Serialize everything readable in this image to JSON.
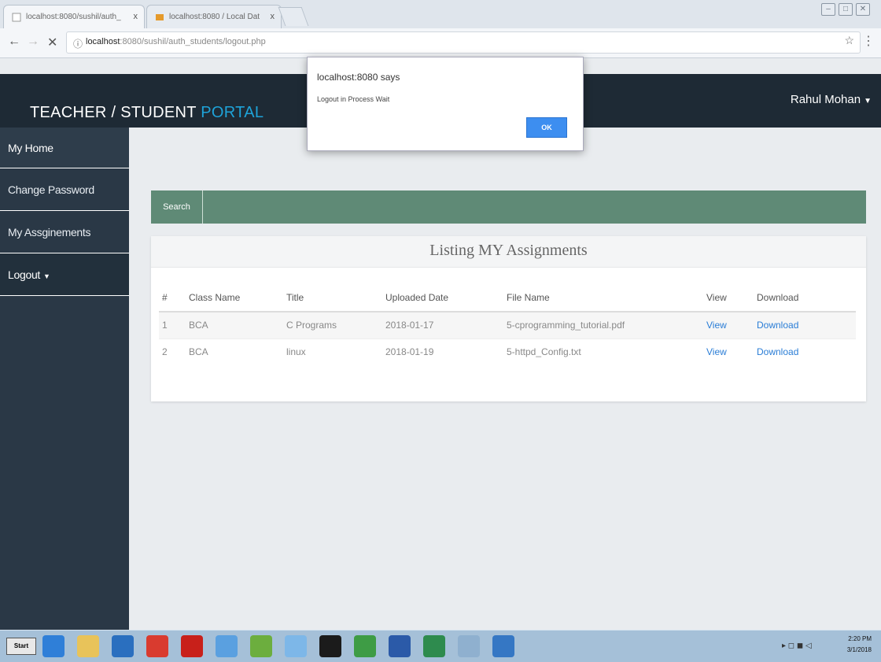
{
  "browser": {
    "tabs": [
      {
        "label": "localhost:8080/sushil/auth_",
        "close": "x"
      },
      {
        "label": "localhost:8080 / Local Dat",
        "close": "x"
      }
    ],
    "url_host": "localhost",
    "url_path": ":8080/sushil/auth_students/logout.php",
    "back_glyph": "←",
    "forward_glyph": "→",
    "stop_glyph": "✕",
    "info_glyph": "ⓘ",
    "star_glyph": "☆",
    "menu_glyph": "⋮"
  },
  "header": {
    "brand_main": "TEACHER / STUDENT ",
    "brand_accent": "PORTAL",
    "user_name": "Rahul Mohan",
    "caret": "▼"
  },
  "sidebar": {
    "items": [
      {
        "label": "My Home"
      },
      {
        "label": "Change Password"
      },
      {
        "label": "My Assginements"
      },
      {
        "label": "Logout"
      }
    ]
  },
  "search": {
    "label": "Search"
  },
  "panel": {
    "title": "Listing MY Assignments",
    "columns": [
      "#",
      "Class Name",
      "Title",
      "Uploaded Date",
      "File Name",
      "View",
      "Download"
    ],
    "rows": [
      {
        "num": "1",
        "class": "BCA",
        "title": "C Programs",
        "date": "2018-01-17",
        "file": "5-cprogramming_tutorial.pdf",
        "view": "View",
        "download": "Download"
      },
      {
        "num": "2",
        "class": "BCA",
        "title": "linux",
        "date": "2018-01-19",
        "file": "5-httpd_Config.txt",
        "view": "View",
        "download": "Download"
      }
    ]
  },
  "alert": {
    "title": "localhost:8080 says",
    "message": "Logout in Process Wait",
    "ok_label": "OK"
  },
  "taskbar": {
    "start_label": "Start",
    "time": "2:20 PM",
    "date": "3/1/2018",
    "icon_colors": {
      "ie": "#2f7fd8",
      "explorer": "#e8c35a",
      "outlook": "#2a6fbf",
      "chrome": "#d93b2f",
      "acrobat": "#c8201a",
      "vscode": "#5aa0e0",
      "notepad": "#6cae3e",
      "paint": "#7db7e8",
      "terminal": "#1b1b1b",
      "xampp": "#3e9c45",
      "word": "#2b5aa8",
      "excel": "#2e8b4e",
      "search": "#8fb0cf",
      "media": "#3577c4"
    }
  }
}
